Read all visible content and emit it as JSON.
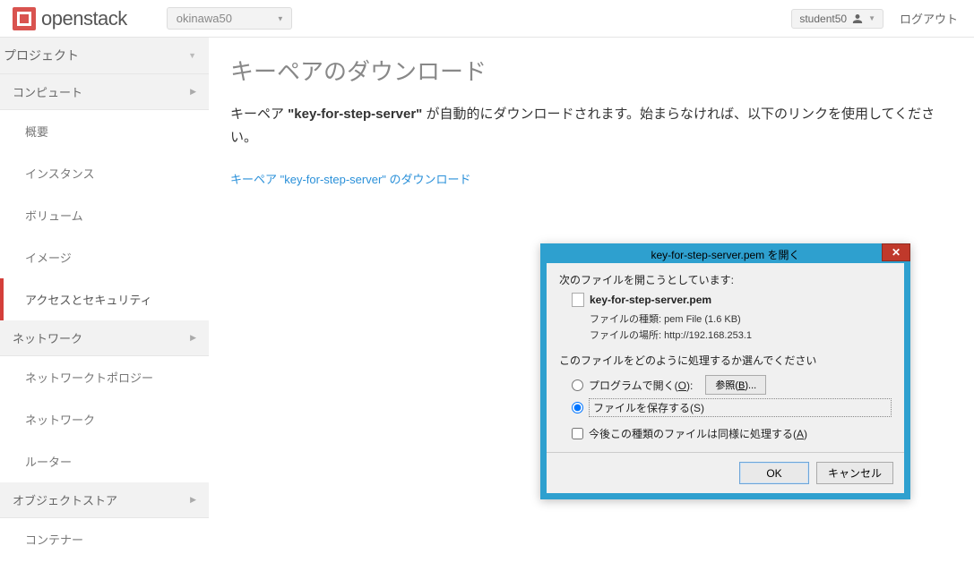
{
  "topbar": {
    "brand": "openstack",
    "project_name": "okinawa50",
    "username": "student50",
    "logout": "ログアウト"
  },
  "sidebar": {
    "project_label": "プロジェクト",
    "compute_label": "コンピュート",
    "items": [
      {
        "label": "概要"
      },
      {
        "label": "インスタンス"
      },
      {
        "label": "ボリューム"
      },
      {
        "label": "イメージ"
      },
      {
        "label": "アクセスとセキュリティ"
      }
    ],
    "network_label": "ネットワーク",
    "network_items": [
      {
        "label": "ネットワークトポロジー"
      },
      {
        "label": "ネットワーク"
      },
      {
        "label": "ルーター"
      }
    ],
    "object_store_label": "オブジェクトストア",
    "object_items": [
      {
        "label": "コンテナー"
      }
    ]
  },
  "main": {
    "title": "キーペアのダウンロード",
    "desc_prefix": "キーペア ",
    "key_name_quoted": "\"key-for-step-server\"",
    "desc_suffix": " が自動的にダウンロードされます。始まらなければ、以下のリンクを使用してください。",
    "link_text": "キーペア \"key-for-step-server\" のダウンロード"
  },
  "dialog": {
    "title": "key-for-step-server.pem を開く",
    "opening_label": "次のファイルを開こうとしています:",
    "filename": "key-for-step-server.pem",
    "filetype_label": "ファイルの種類:",
    "filetype_value": "pem File (1.6 KB)",
    "location_label": "ファイルの場所:",
    "location_value": "http://192.168.253.1",
    "prompt": "このファイルをどのように処理するか選んでください",
    "open_with_pre": "プログラムで開く(",
    "open_with_ul": "O",
    "open_with_post": "):",
    "browse_pre": "参照(",
    "browse_ul": "B",
    "browse_post": ")...",
    "save_pre": "ファイルを保存する(",
    "save_ul": "S",
    "save_post": ")",
    "remember_pre": "今後この種類のファイルは同様に処理する(",
    "remember_ul": "A",
    "remember_post": ")",
    "ok": "OK",
    "cancel": "キャンセル"
  }
}
